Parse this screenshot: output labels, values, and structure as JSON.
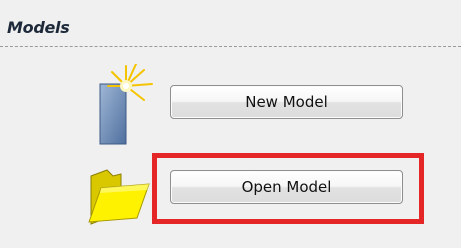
{
  "panel": {
    "title": "Models"
  },
  "actions": {
    "new_model_label": "New Model",
    "open_model_label": "Open Model"
  },
  "icons": {
    "new_model": "new-document-icon",
    "open_model": "folder-icon"
  },
  "colors": {
    "highlight": "#e52626",
    "folder": "#f5e400",
    "document": "#6d8fbf"
  }
}
